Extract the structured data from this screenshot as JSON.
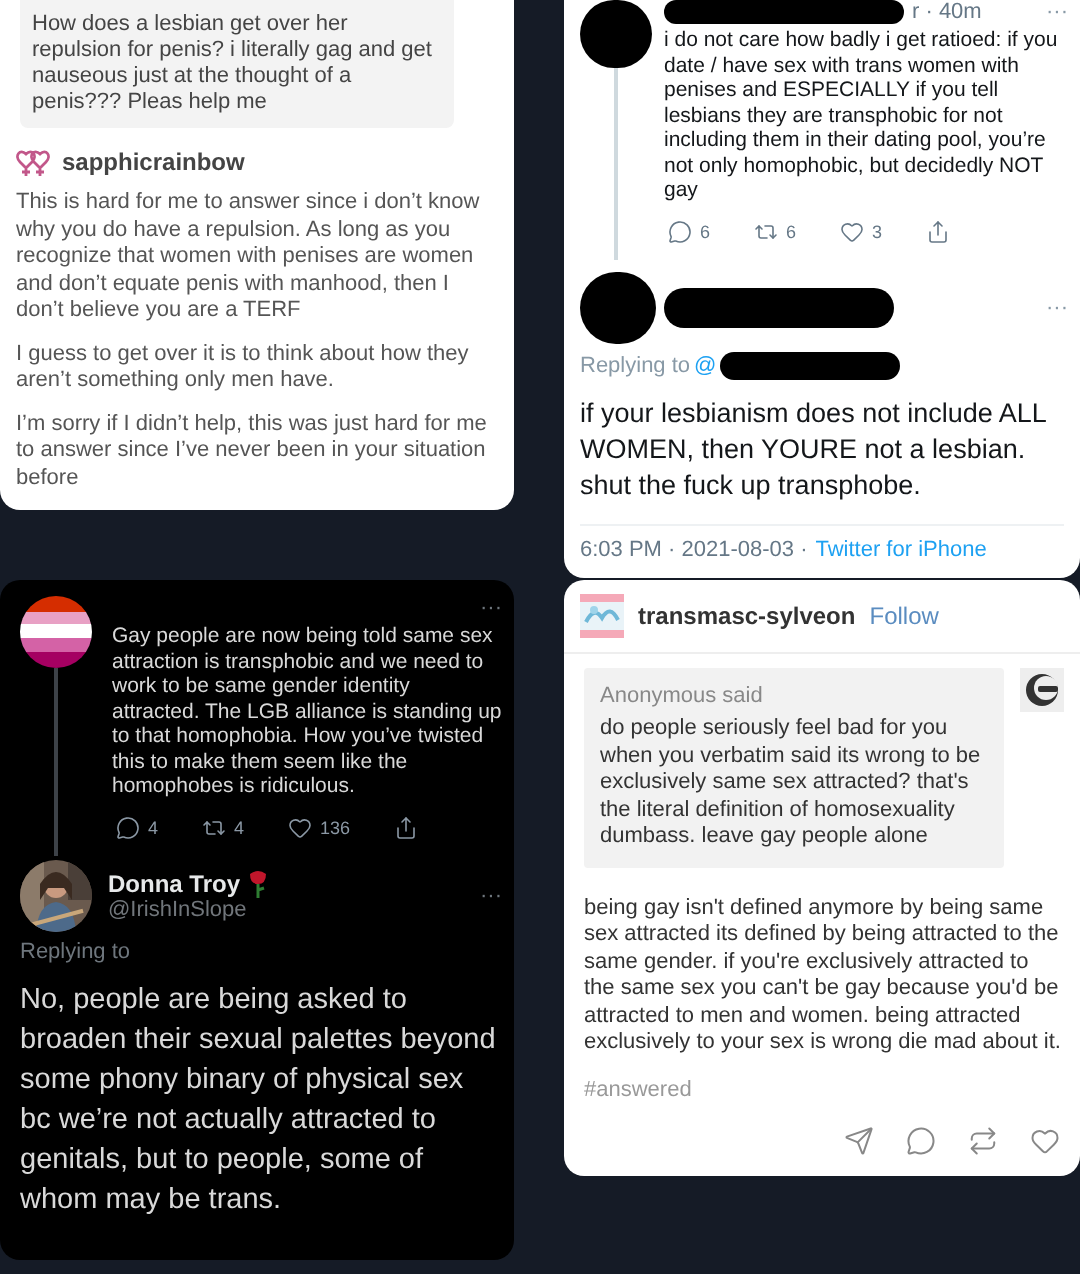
{
  "ask_post": {
    "question": "How does a lesbian get over her repulsion for penis? i literally gag and get nauseous just at the thought of a penis??? Pleas help me",
    "author": "sapphicrainbow",
    "paragraphs": [
      "This is hard for me to answer since i don’t know why you do have a repulsion. As long as you recognize that women with penises are women and don’t equate penis with manhood, then I don’t believe you are a TERF",
      "I guess to get over it is to think about how they aren’t something only men have.",
      "I’m sorry if I didn’t help, this was just hard for me to answer since I’ve never been in your situation before"
    ]
  },
  "light_thread": {
    "tweet": {
      "meta": "r · 40m",
      "more": "···",
      "text": "i do not care how badly i get ratioed: if you date / have sex with trans women with penises and ESPECIALLY if you tell lesbians they are transphobic for not including them in their dating pool, you’re not only homophobic, but decidedly NOT gay",
      "actions": [
        {
          "kind": "reply",
          "count": "6"
        },
        {
          "kind": "retweet",
          "count": "6"
        },
        {
          "kind": "like",
          "count": "3"
        },
        {
          "kind": "share"
        }
      ]
    },
    "reply": {
      "more": "···",
      "replying_to": "Replying to",
      "mention": "@",
      "text": "if your lesbianism does not include ALL WOMEN, then YOURE not a lesbian. shut the fuck up transphobe.",
      "timestamp": "6:03 PM · 2021-08-03 ·",
      "source": "Twitter for iPhone"
    }
  },
  "dark_thread": {
    "tweet": {
      "more": "···",
      "text": "Gay people are now being told same sex attraction is transphobic and we need to work to be same gender identity attracted. The LGB alliance is standing up to that homophobia. How you’ve twisted this to make them seem like the homophobes is ridiculous.",
      "actions": [
        {
          "kind": "reply",
          "count": "4"
        },
        {
          "kind": "retweet",
          "count": "4"
        },
        {
          "kind": "like",
          "count": "136"
        },
        {
          "kind": "share"
        }
      ]
    },
    "reply": {
      "name": "Donna Troy",
      "handle": "@IrishInSlope",
      "more": "···",
      "replying_to": "Replying to",
      "text": "No, people are being asked to broaden their sexual palettes beyond some phony binary of physical sex bc we’re not actually attracted to genitals, but to people, some of whom may be trans."
    }
  },
  "tumblr_post": {
    "blog": "transmasc-sylveon",
    "follow": "Follow",
    "ask_label": "Anonymous said",
    "question": "do people seriously feel bad for you when you verbatim said its wrong to be exclusively same sex attracted? that's the literal definition of homosexuality dumbass. leave gay people alone",
    "answer": "being gay isn't defined anymore by being same sex attracted its defined by being attracted to the same gender. if you're exclusively attracted to the same sex you can't be gay because you'd be attracted to men and women. being attracted exclusively to your sex is wrong die mad about it.",
    "tag": "#answered",
    "actions": [
      {
        "kind": "share"
      },
      {
        "kind": "reply"
      },
      {
        "kind": "reblog"
      },
      {
        "kind": "like"
      }
    ]
  }
}
